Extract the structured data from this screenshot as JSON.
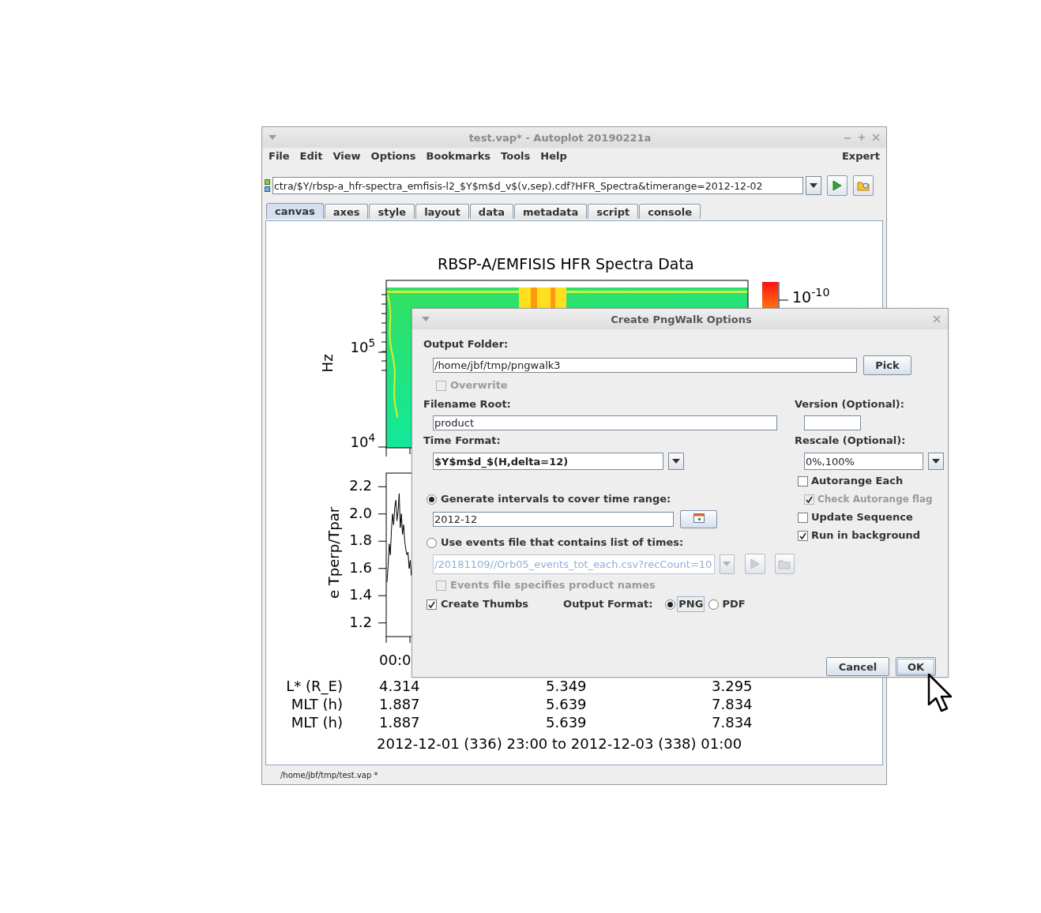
{
  "window": {
    "title": "test.vap* - Autoplot 20190221a"
  },
  "menu": [
    "File",
    "Edit",
    "View",
    "Options",
    "Bookmarks",
    "Tools",
    "Help"
  ],
  "menu_right": "Expert",
  "address": {
    "value": "ctra/$Y/rbsp-a_hfr-spectra_emfisis-l2_$Y$m$d_v$(v,sep).cdf?HFR_Spectra&timerange=2012-12-02"
  },
  "tabs": [
    {
      "label": "canvas",
      "selected": true
    },
    {
      "label": "axes",
      "selected": false
    },
    {
      "label": "style",
      "selected": false
    },
    {
      "label": "layout",
      "selected": false
    },
    {
      "label": "data",
      "selected": false
    },
    {
      "label": "metadata",
      "selected": false
    },
    {
      "label": "script",
      "selected": false
    },
    {
      "label": "console",
      "selected": false
    }
  ],
  "plot": {
    "title": "RBSP-A/EMFISIS  HFR Spectra Data",
    "colorbar_label": "10$^{-10}$",
    "spectrogram": {
      "ylabel": "Hz",
      "yticks": [
        "10$^{5}$",
        "10$^{4}$"
      ]
    },
    "line_plot": {
      "chart_data": {
        "type": "line",
        "ylabel": "e Tperp/Tpar",
        "ylim": [
          1.1,
          2.3
        ],
        "yticks": [
          {
            "value": 2.2,
            "label": "2.2"
          },
          {
            "value": 2.0,
            "label": "2.0"
          },
          {
            "value": 1.8,
            "label": "1.8"
          },
          {
            "value": 1.6,
            "label": "1.6"
          },
          {
            "value": 1.4,
            "label": "1.4"
          },
          {
            "value": 1.2,
            "label": "1.2"
          }
        ],
        "series": [
          {
            "color": "#000000",
            "values": [
              1.5,
              1.62,
              1.78,
              1.7,
              1.88,
              2.0,
              1.92,
              2.05,
              2.1,
              1.95,
              2.02,
              2.15,
              1.9,
              2.0,
              1.85,
              1.92,
              1.8,
              1.74,
              1.7,
              1.72,
              1.6,
              1.66,
              1.55,
              1.6
            ]
          }
        ]
      }
    },
    "x_tick": "00:0",
    "ephemeris": [
      {
        "label": "L* (R_E)",
        "values": [
          "4.314",
          "5.349",
          "3.295"
        ]
      },
      {
        "label": "MLT (h)",
        "values": [
          "1.887",
          "5.639",
          "7.834"
        ]
      },
      {
        "label": "MLT (h)",
        "values": [
          "1.887",
          "5.639",
          "7.834"
        ]
      }
    ],
    "range": "2012-12-01 (336) 23:00 to 2012-12-03 (338) 01:00"
  },
  "status_bar": "/home/jbf/tmp/test.vap *",
  "dialog": {
    "title": "Create PngWalk Options",
    "output_folder": {
      "label": "Output Folder:",
      "value": "/home/jbf/tmp/pngwalk3",
      "button": "Pick"
    },
    "overwrite": {
      "label": "Overwrite",
      "checked": false,
      "disabled": true
    },
    "filename_root": {
      "label": "Filename Root:",
      "value": "product"
    },
    "version": {
      "label": "Version (Optional):"
    },
    "time_format": {
      "label": "Time Format:",
      "value": "$Y$m$d_$(H,delta=12)"
    },
    "rescale": {
      "label": "Rescale (Optional):",
      "value": "0%,100%"
    },
    "options": [
      {
        "label": "Autorange Each",
        "checked": false,
        "disabled": false
      },
      {
        "label": "Check Autorange flag",
        "checked": true,
        "disabled": true
      },
      {
        "label": "Update Sequence",
        "checked": false,
        "disabled": false
      },
      {
        "label": "Run in background",
        "checked": true,
        "disabled": false
      }
    ],
    "modes": [
      {
        "label": "Generate intervals to cover time range:",
        "selected": true
      },
      {
        "label": "Use events file that contains list of times:",
        "selected": false
      }
    ],
    "time_range": "2012-12",
    "events_file": {
      "value": "/20181109//Orb05_events_tot_each.csv?recCount=10",
      "disabled": true
    },
    "events_names": {
      "label": "Events file specifies product names",
      "checked": false,
      "disabled": true
    },
    "create_thumbs": {
      "label": "Create Thumbs",
      "checked": true
    },
    "output_format": {
      "label": "Output Format:",
      "options": [
        {
          "label": "PNG",
          "selected": true
        },
        {
          "label": "PDF",
          "selected": false
        }
      ]
    },
    "buttons": [
      "Cancel",
      "OK"
    ]
  }
}
